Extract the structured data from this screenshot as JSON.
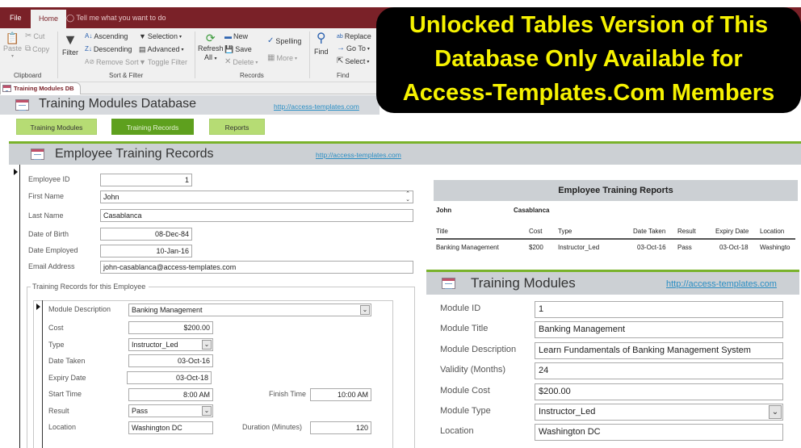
{
  "ribbon": {
    "tabs": [
      {
        "label": "File",
        "active": false
      },
      {
        "label": "Home",
        "active": true
      }
    ],
    "tell_me": "Tell me what you want to do",
    "clipboard": {
      "paste": "Paste",
      "cut": "Cut",
      "copy": "Copy",
      "group_label": "Clipboard"
    },
    "sort_filter": {
      "filter": "Filter",
      "ascending": "Ascending",
      "descending": "Descending",
      "remove_sort": "Remove Sort",
      "selection": "Selection",
      "advanced": "Advanced",
      "toggle_filter": "Toggle Filter",
      "group_label": "Sort & Filter"
    },
    "records": {
      "refresh": "Refresh",
      "refresh_all": "All",
      "new": "New",
      "save": "Save",
      "delete": "Delete",
      "spelling": "Spelling",
      "more": "More",
      "group_label": "Records"
    },
    "find": {
      "find": "Find",
      "replace": "Replace",
      "go_to": "Go To",
      "select": "Select",
      "group_label": "Find"
    }
  },
  "document_tab": "Training Modules DB",
  "main_header": {
    "title": "Training Modules Database",
    "link": "http://access-templates.com"
  },
  "nav_buttons": [
    {
      "label": "Training Modules",
      "active": false
    },
    {
      "label": "Training Records",
      "active": true
    },
    {
      "label": "Reports",
      "active": false
    }
  ],
  "employee_form": {
    "title": "Employee Training Records",
    "link": "http://access-templates.com",
    "fields": {
      "employee_id": {
        "label": "Employee ID",
        "value": "1"
      },
      "first_name": {
        "label": "First Name",
        "value": "John"
      },
      "last_name": {
        "label": "Last Name",
        "value": "Casablanca"
      },
      "date_of_birth": {
        "label": "Date of Birth",
        "value": "08-Dec-84"
      },
      "date_employed": {
        "label": "Date Employed",
        "value": "10-Jan-16"
      },
      "email": {
        "label": "Email Address",
        "value": "john-casablanca@access-templates.com"
      }
    },
    "training_group_label": "Training Records for this Employee",
    "training_record": {
      "module_description": {
        "label": "Module Description",
        "value": "Banking Management"
      },
      "cost": {
        "label": "Cost",
        "value": "$200.00"
      },
      "type": {
        "label": "Type",
        "value": "Instructor_Led"
      },
      "date_taken": {
        "label": "Date Taken",
        "value": "03-Oct-16"
      },
      "expiry_date": {
        "label": "Expiry Date",
        "value": "03-Oct-18"
      },
      "start_time": {
        "label": "Start Time",
        "value": "8:00 AM"
      },
      "finish_time": {
        "label": "Finish Time",
        "value": "10:00 AM"
      },
      "result": {
        "label": "Result",
        "value": "Pass"
      },
      "location": {
        "label": "Location",
        "value": "Washington DC"
      },
      "duration": {
        "label": "Duration (Minutes)",
        "value": "120"
      }
    }
  },
  "report": {
    "title": "Employee Training Reports",
    "first_name": "John",
    "last_name": "Casablanca",
    "columns": [
      "Title",
      "Cost",
      "Type",
      "Date Taken",
      "Result",
      "Expiry Date",
      "Location"
    ],
    "rows": [
      [
        "Banking Management",
        "$200",
        "Instructor_Led",
        "03-Oct-16",
        "Pass",
        "03-Oct-18",
        "Washingto"
      ]
    ]
  },
  "training_modules": {
    "title": "Training Modules",
    "link": "http://access-templates.com",
    "fields": [
      {
        "label": "Module ID",
        "value": "1"
      },
      {
        "label": "Module Title",
        "value": "Banking Management"
      },
      {
        "label": "Module Description",
        "value": "Learn Fundamentals of Banking Management System"
      },
      {
        "label": "Validity (Months)",
        "value": "24"
      },
      {
        "label": "Module Cost",
        "value": "$200.00"
      },
      {
        "label": "Module Type",
        "value": "Instructor_Led"
      },
      {
        "label": "Location",
        "value": "Washington DC"
      }
    ]
  },
  "banner": {
    "lines": [
      "Unlocked Tables Version of This",
      "Database Only Available for",
      "Access-Templates.Com Members"
    ],
    "text_color": "#f6f200",
    "background": "#000000"
  },
  "colors": {
    "ribbon_brand": "#7a2128",
    "nav_button": "#b6dc74",
    "nav_button_active": "#5ea01e",
    "accent_green": "#79b22b",
    "link": "#2a8ec4"
  }
}
